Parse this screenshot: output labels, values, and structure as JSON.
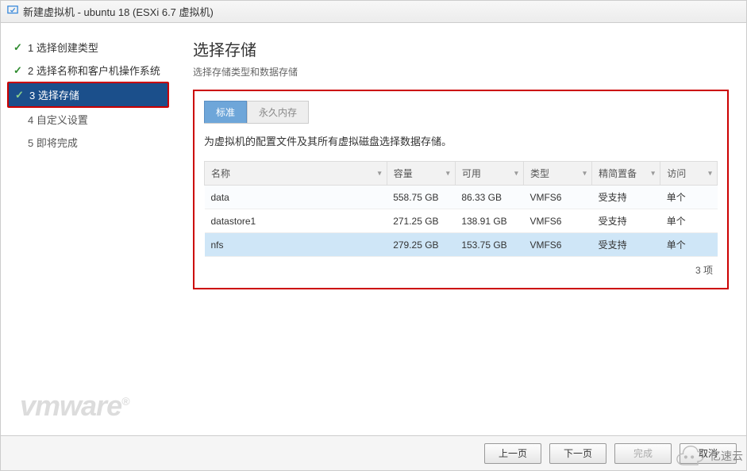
{
  "titlebar": {
    "text": "新建虚拟机 - ubuntu 18 (ESXi 6.7 虚拟机)"
  },
  "sidebar": {
    "steps": [
      {
        "label": "1 选择创建类型"
      },
      {
        "label": "2 选择名称和客户机操作系统"
      },
      {
        "label": "3 选择存储"
      },
      {
        "label": "4 自定义设置"
      },
      {
        "label": "5 即将完成"
      }
    ]
  },
  "main": {
    "title": "选择存储",
    "subtitle": "选择存储类型和数据存储",
    "tabs": {
      "standard": "标准",
      "pmem": "永久内存"
    },
    "description": "为虚拟机的配置文件及其所有虚拟磁盘选择数据存储。",
    "columns": {
      "name": "名称",
      "capacity": "容量",
      "free": "可用",
      "type": "类型",
      "thin": "精简置备",
      "access": "访问"
    },
    "rows": [
      {
        "name": "data",
        "capacity": "558.75 GB",
        "free": "86.33 GB",
        "type": "VMFS6",
        "thin": "受支持",
        "access": "单个"
      },
      {
        "name": "datastore1",
        "capacity": "271.25 GB",
        "free": "138.91 GB",
        "type": "VMFS6",
        "thin": "受支持",
        "access": "单个"
      },
      {
        "name": "nfs",
        "capacity": "279.25 GB",
        "free": "153.75 GB",
        "type": "VMFS6",
        "thin": "受支持",
        "access": "单个"
      }
    ],
    "footer_count": "3 项"
  },
  "footer": {
    "back": "上一页",
    "next": "下一页",
    "finish": "完成",
    "cancel": "取消"
  },
  "logo": "vmware",
  "badge": "亿速云"
}
